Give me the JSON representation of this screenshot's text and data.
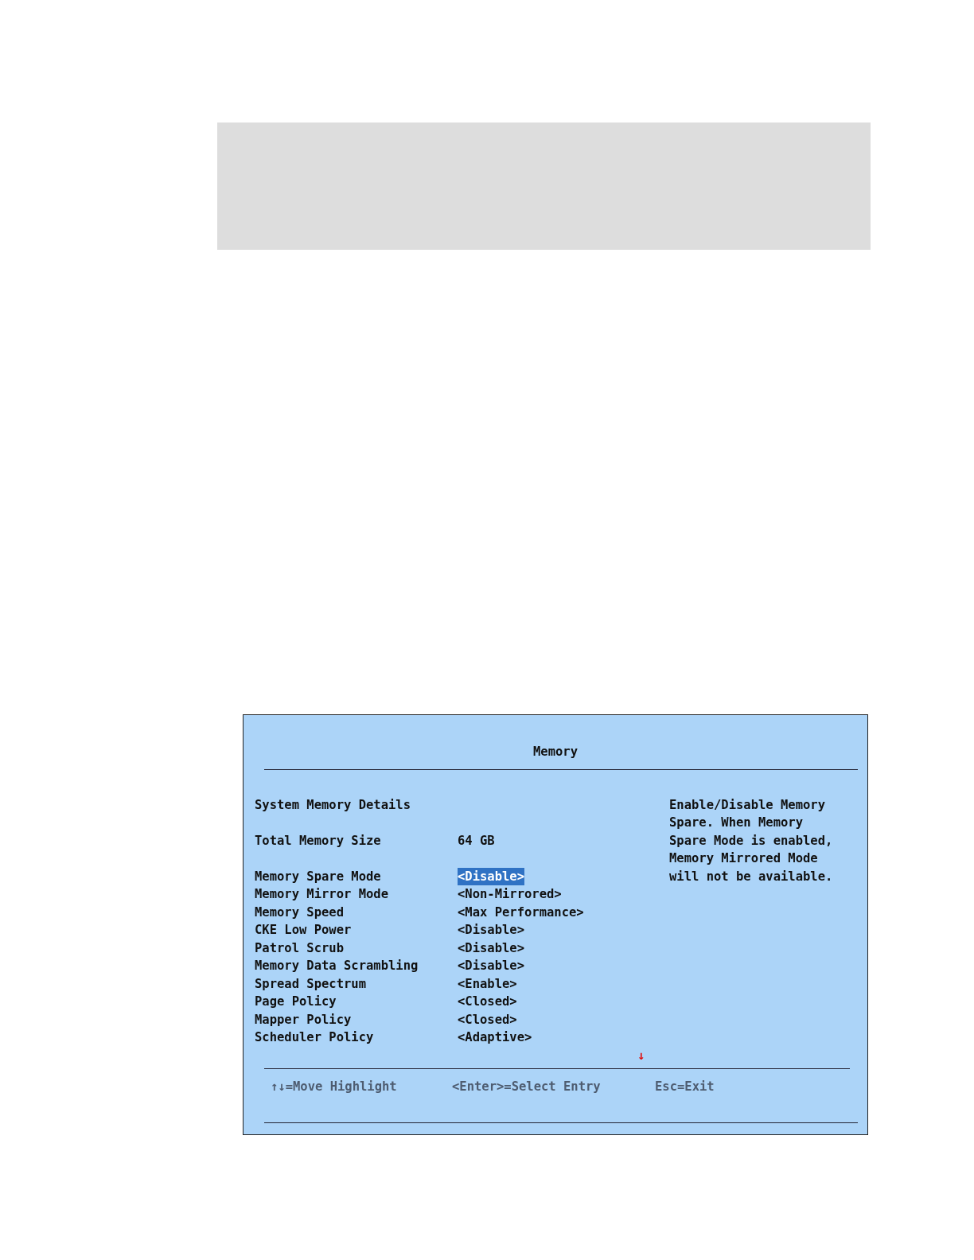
{
  "screen": {
    "title": "Memory",
    "section_heading": "System Memory Details",
    "info_rows": [
      {
        "label": "Total Memory Size",
        "value": "64 GB"
      }
    ],
    "options": [
      {
        "label": "Memory Spare Mode",
        "value": "<Disable>",
        "selected": true
      },
      {
        "label": "Memory Mirror Mode",
        "value": "<Non-Mirrored>",
        "selected": false
      },
      {
        "label": "Memory Speed",
        "value": "<Max Performance>",
        "selected": false
      },
      {
        "label": "CKE Low Power",
        "value": "<Disable>",
        "selected": false
      },
      {
        "label": "Patrol Scrub",
        "value": "<Disable>",
        "selected": false
      },
      {
        "label": "Memory Data Scrambling",
        "value": "<Disable>",
        "selected": false
      },
      {
        "label": "Spread Spectrum",
        "value": "<Enable>",
        "selected": false
      },
      {
        "label": "Page Policy",
        "value": "<Closed>",
        "selected": false
      },
      {
        "label": "Mapper Policy",
        "value": "<Closed>",
        "selected": false
      },
      {
        "label": "Scheduler Policy",
        "value": "<Adaptive>",
        "selected": false
      }
    ],
    "help_text": [
      "Enable/Disable Memory",
      "Spare. When Memory",
      "Spare Mode is enabled,",
      "Memory Mirrored Mode",
      "will not be available."
    ],
    "scroll_indicator": "↓",
    "key_hints": [
      "↑↓=Move Highlight",
      "<Enter>=Select Entry",
      "Esc=Exit"
    ]
  }
}
